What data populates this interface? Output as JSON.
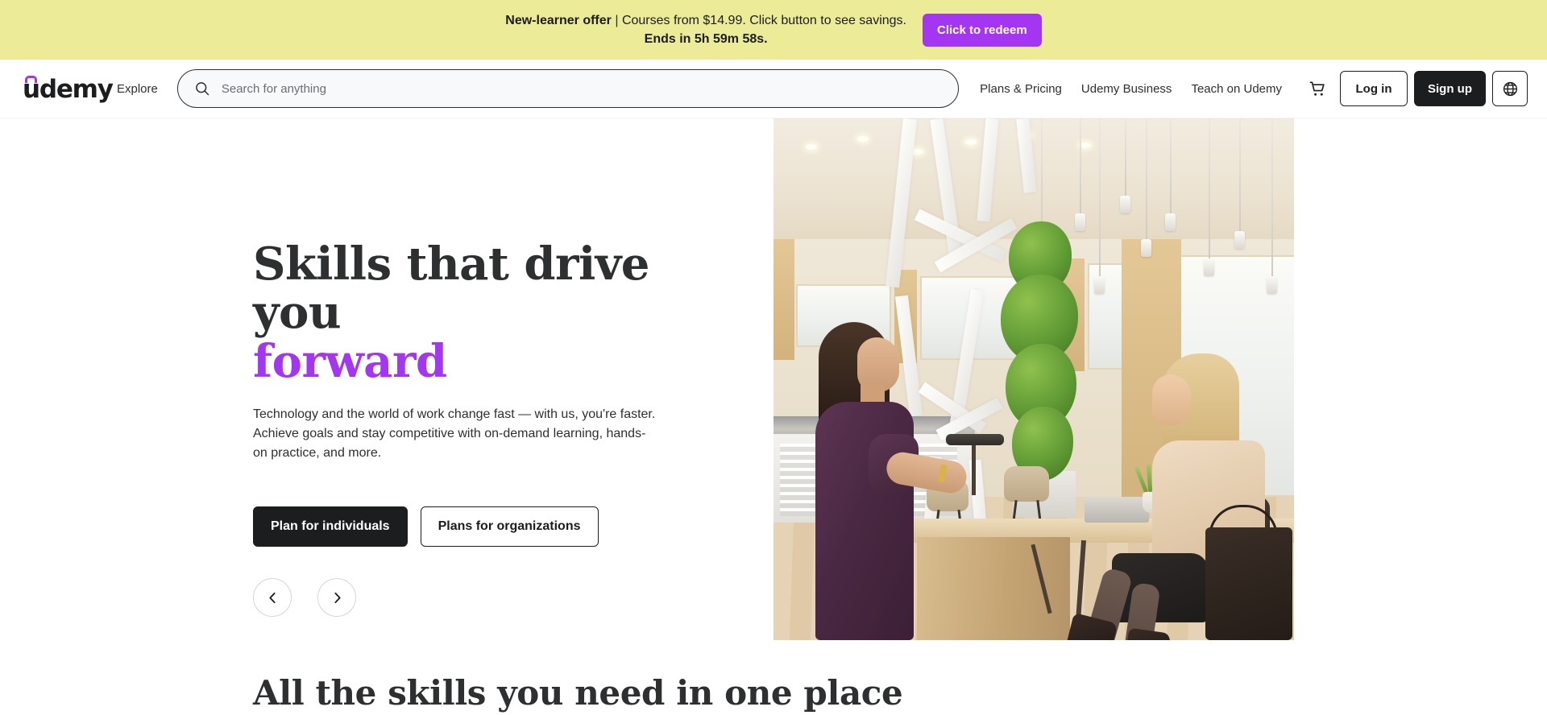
{
  "promo": {
    "offer_label": "New-learner offer",
    "separator": "|",
    "detail": "Courses from $14.99. Click button to see savings.",
    "countdown": "Ends in 5h 59m 58s.",
    "cta_label": "Click to redeem",
    "background_color": "#ECEB98",
    "cta_color": "#A435F0"
  },
  "header": {
    "logo_text": "udemy",
    "explore_label": "Explore",
    "search": {
      "placeholder": "Search for anything",
      "value": "",
      "icon": "search-icon"
    },
    "nav_links": [
      {
        "label": "Plans & Pricing"
      },
      {
        "label": "Udemy Business"
      },
      {
        "label": "Teach on Udemy"
      }
    ],
    "cart_icon": "shopping-cart-icon",
    "login_label": "Log in",
    "signup_label": "Sign up",
    "language_icon": "globe-icon"
  },
  "hero": {
    "title_line1": "Skills that drive you",
    "title_line2": "forward",
    "title_accent_color": "#A435F0",
    "subtitle": "Technology and the world of work change fast — with us, you're faster. Achieve goals and stay competitive with on-demand learning, hands-on practice, and more.",
    "cta_primary": "Plan for individuals",
    "cta_secondary": "Plans for organizations",
    "carousel": {
      "prev_icon": "chevron-left-icon",
      "next_icon": "chevron-right-icon"
    },
    "image_alt": "Two women talking at a high table in a modern bright office with plants and pendant lamps"
  },
  "section": {
    "heading": "All the skills you need in one place"
  }
}
